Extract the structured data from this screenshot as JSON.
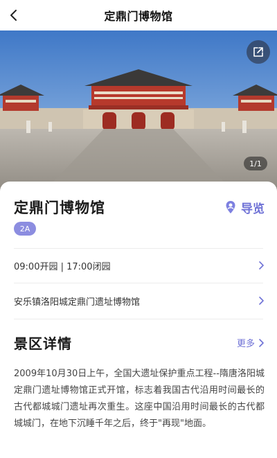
{
  "nav": {
    "title": "定鼎门博物馆",
    "back_icon": "chevron-left-icon"
  },
  "hero": {
    "share_icon": "share-icon",
    "page_indicator": "1/1"
  },
  "place": {
    "name": "定鼎门博物馆",
    "guide_label": "导览",
    "guide_icon": "map-pin-user-icon",
    "rating_badge": "2A",
    "accent_color": "#6f72d6"
  },
  "hours": {
    "text": "09:00开园 | 17:00闭园"
  },
  "address": {
    "text": "安乐镇洛阳城定鼎门遗址博物馆"
  },
  "details": {
    "section_title": "景区详情",
    "more_label": "更多",
    "description": "2009年10月30日上午，全国大遗址保护重点工程--隋唐洛阳城定鼎门遗址博物馆正式开馆，标志着我国古代沿用时间最长的古代都城城门遗址再次重生。这座中国沿用时间最长的古代都城城门，在地下沉睡千年之后，终于\"再现\"地面。"
  }
}
